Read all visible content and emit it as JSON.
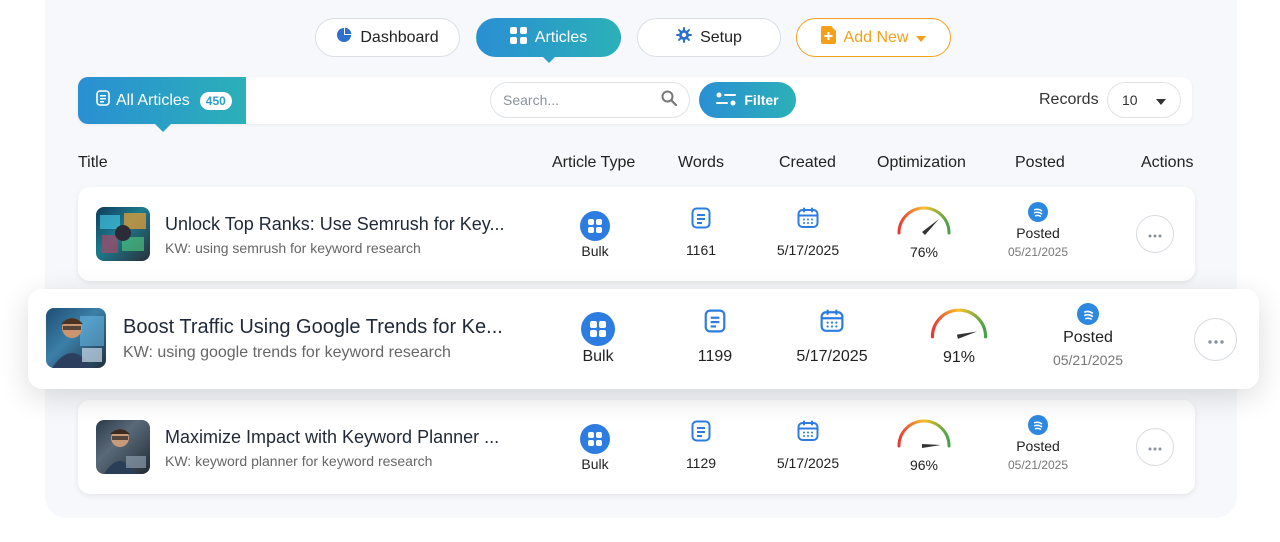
{
  "nav": {
    "dashboard_label": "Dashboard",
    "articles_label": "Articles",
    "setup_label": "Setup",
    "add_new_label": "Add New"
  },
  "toolbar": {
    "all_articles_label": "All Articles",
    "all_articles_count": "450",
    "search_placeholder": "Search...",
    "filter_label": "Filter",
    "records_label": "Records",
    "records_value": "10"
  },
  "table": {
    "headers": {
      "title": "Title",
      "article_type": "Article Type",
      "words": "Words",
      "created": "Created",
      "optimization": "Optimization",
      "posted": "Posted",
      "actions": "Actions"
    },
    "rows": [
      {
        "title": "Unlock Top Ranks: Use Semrush for Key...",
        "kw": "KW: using semrush for keyword research",
        "type": "Bulk",
        "words": "1161",
        "created": "5/17/2025",
        "optimization": "76%",
        "optimization_value": 76,
        "posted_status": "Posted",
        "posted_date": "05/21/2025"
      },
      {
        "title": "Boost Traffic Using Google Trends for Ke...",
        "kw": "KW: using google trends for keyword research",
        "type": "Bulk",
        "words": "1199",
        "created": "5/17/2025",
        "optimization": "91%",
        "optimization_value": 91,
        "posted_status": "Posted",
        "posted_date": "05/21/2025"
      },
      {
        "title": "Maximize Impact with Keyword Planner ...",
        "kw": "KW: keyword planner for keyword research",
        "type": "Bulk",
        "words": "1129",
        "created": "5/17/2025",
        "optimization": "96%",
        "optimization_value": 96,
        "posted_status": "Posted",
        "posted_date": "05/21/2025"
      }
    ]
  },
  "colors": {
    "accent_start": "#2a8fd3",
    "accent_end": "#2bb0b8",
    "add_new": "#f4a01b",
    "bulk_icon": "#2d7ce0"
  }
}
